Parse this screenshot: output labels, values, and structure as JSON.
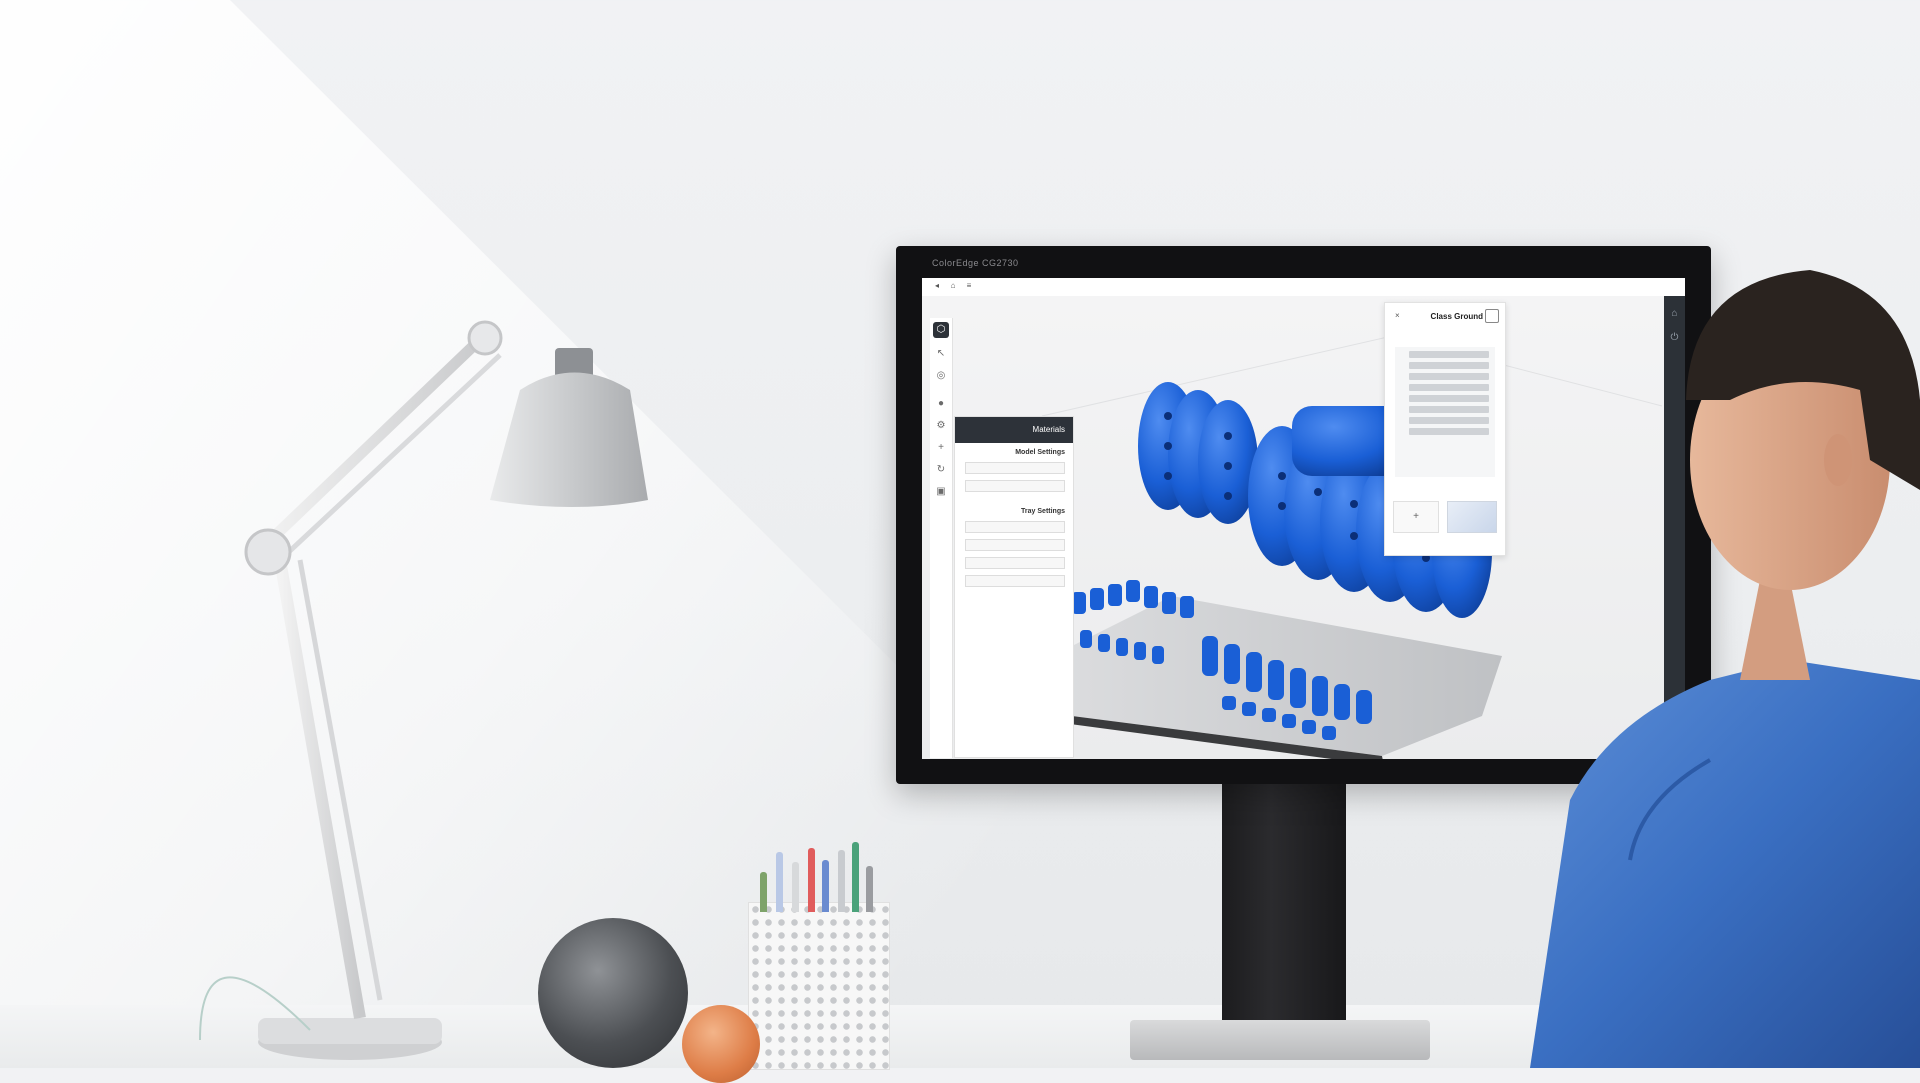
{
  "scene": {
    "description_labels": {
      "monitor_brand": "ColorEdge CG2730",
      "topbar_title": "",
      "panel_header": "Materials",
      "right_panel_title": "Class Ground"
    }
  },
  "app": {
    "left_panel": {
      "header": "Materials",
      "section_1_title": "Model Settings",
      "section_2_title": "Tray Settings",
      "fields": [
        "",
        "",
        "",
        "",
        "",
        "",
        ""
      ]
    },
    "right_panel": {
      "title": "Class Ground",
      "add_label": "+"
    }
  },
  "colors": {
    "part_blue": "#1a5fd6",
    "panel_dark": "#2d3239",
    "plate_grey": "#cfd0d2"
  }
}
